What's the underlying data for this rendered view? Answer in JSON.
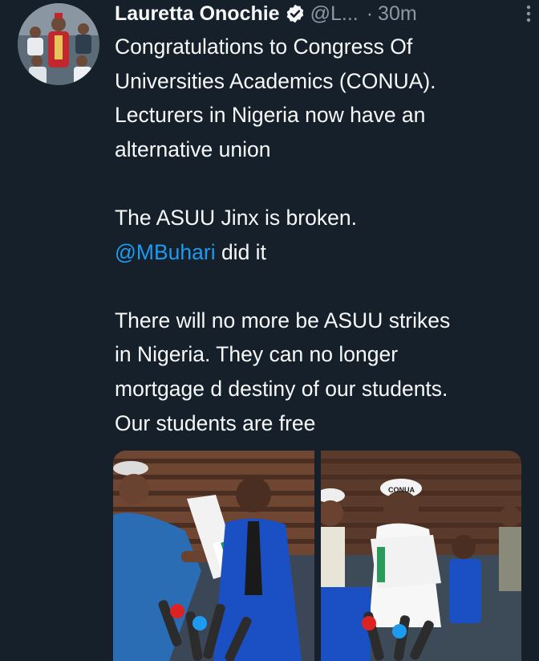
{
  "tweet": {
    "author_name": "Lauretta Onochie",
    "handle": "@L...",
    "separator": "·",
    "time": "30m",
    "paragraphs": [
      [
        "Congratulations to Congress Of",
        "Universities Academics (CONUA).",
        "Lecturers in Nigeria now have an",
        "alternative union"
      ],
      [
        "The ASUU Jinx is broken."
      ],
      [
        "There will no more be ASUU strikes",
        "in Nigeria. They can no longer",
        "mortgage d destiny of our students.",
        "Our students are free"
      ]
    ],
    "mention": "@MBuhari",
    "mention_suffix": " did it"
  },
  "colors": {
    "background": "#15202b",
    "text": "#f7f9f9",
    "muted": "#8b98a5",
    "accent": "#1d9bf0"
  },
  "icons": {
    "verified": "verified-badge-icon",
    "more": "more-vertical-icon"
  },
  "media": {
    "photo_count": 2,
    "visible_text": [
      "CONUA"
    ]
  }
}
